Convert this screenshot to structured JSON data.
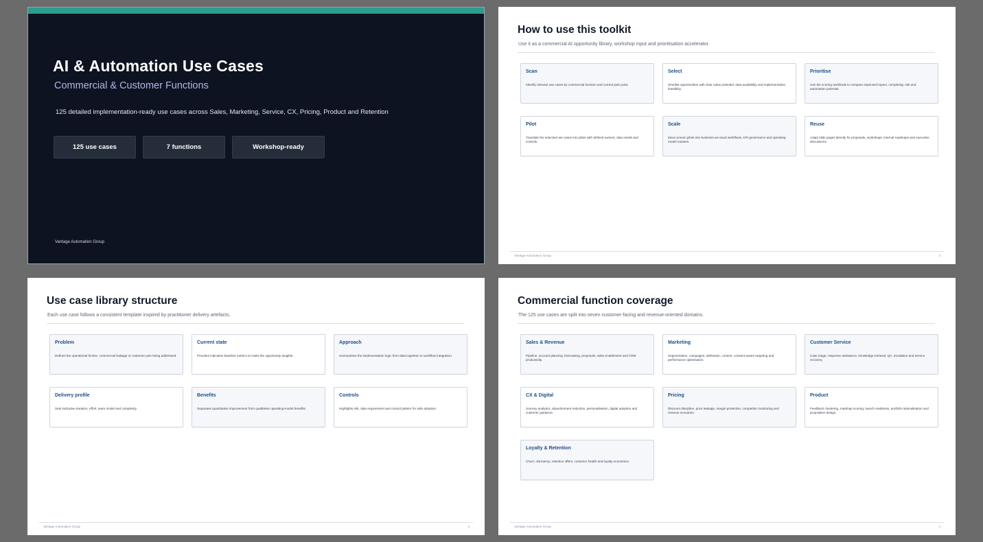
{
  "cover": {
    "title": "AI & Automation Use Cases",
    "subtitle": "Commercial & Customer Functions",
    "description": "125 detailed implementation-ready use cases across Sales, Marketing, Service, CX, Pricing, Product and Retention",
    "pills": [
      "125 use cases",
      "7 functions",
      "Workshop-ready"
    ],
    "footer": "Vantage Automation Group",
    "colors": {
      "background": "#0d1321",
      "accent_bar": "#2a9d8f"
    }
  },
  "toolkit": {
    "title": "How to use this toolkit",
    "subtitle": "Use it as a commercial AI opportunity library, workshop input and prioritisation accelerator.",
    "cards": [
      {
        "title": "Scan",
        "body": "Identify relevant use cases by commercial function and current pain point."
      },
      {
        "title": "Select",
        "body": "Shortlist opportunities with clear value potential, data availability and implementation feasibility."
      },
      {
        "title": "Prioritise",
        "body": "Use the scoring workbook to compare expected impact, complexity, risk and automation potential."
      },
      {
        "title": "Pilot",
        "body": "Translate the selected use cases into pilots with defined owners, data needs and controls."
      },
      {
        "title": "Scale",
        "body": "Move proven pilots into business-as-usual workflows, KPI governance and operating model routines."
      },
      {
        "title": "Reuse",
        "body": "Adapt slide pages directly for proposals, workshops, internal roadmaps and executive discussions."
      }
    ],
    "footer_left": "Vantage Automation Group",
    "page_number": "2"
  },
  "structure": {
    "title": "Use case library structure",
    "subtitle": "Each use case follows a consistent template inspired by practitioner delivery artefacts.",
    "cards": [
      {
        "title": "Problem",
        "body": "Defines the operational friction, commercial leakage or customer pain being addressed."
      },
      {
        "title": "Current state",
        "body": "Provides indicative baseline metrics to make the opportunity tangible."
      },
      {
        "title": "Approach",
        "body": "Summarises the implementation logic from data ingestion to workflow integration."
      },
      {
        "title": "Delivery profile",
        "body": "Sets indicative duration, effort, team model and complexity."
      },
      {
        "title": "Benefits",
        "body": "Separates quantitative improvement from qualitative operating-model benefits."
      },
      {
        "title": "Controls",
        "body": "Highlights risk, data requirement and control pattern for safe adoption."
      }
    ],
    "footer_left": "Vantage Automation Group",
    "page_number": "3"
  },
  "coverage": {
    "title": "Commercial function coverage",
    "subtitle": "The 125 use cases are split into seven customer-facing and revenue-oriented domains.",
    "cards": [
      {
        "title": "Sales & Revenue",
        "body": "Pipeline, account planning, forecasting, proposals, sales enablement and CRM productivity."
      },
      {
        "title": "Marketing",
        "body": "Segmentation, campaigns, attribution, content, consent-aware targeting and performance optimisation."
      },
      {
        "title": "Customer Service",
        "body": "Case triage, response assistance, knowledge retrieval, QA, escalation and service recovery."
      },
      {
        "title": "CX & Digital",
        "body": "Journey analytics, abandonment reduction, personalisation, digital adoption and customer guidance."
      },
      {
        "title": "Pricing",
        "body": "Discount discipline, price leakage, margin protection, competitor monitoring and revenue scenarios."
      },
      {
        "title": "Product",
        "body": "Feedback clustering, roadmap scoring, launch readiness, portfolio rationalisation and proposition design."
      },
      {
        "title": "Loyalty & Retention",
        "body": "Churn, dormancy, retention offers, customer health and loyalty economics."
      }
    ],
    "footer_left": "Vantage Automation Group",
    "page_number": "4"
  }
}
